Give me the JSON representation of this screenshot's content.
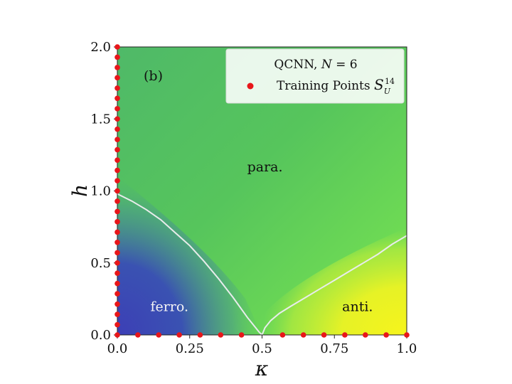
{
  "chart_data": {
    "type": "heatmap",
    "panel_label": "(b)",
    "xlabel": "κ",
    "ylabel": "h",
    "xlim": [
      0,
      1
    ],
    "ylim": [
      0,
      2
    ],
    "xticks": [
      "0.0",
      "0.25",
      "0.5",
      "0.75",
      "1.0"
    ],
    "xtick_values": [
      0,
      0.25,
      0.5,
      0.75,
      1.0
    ],
    "yticks": [
      "0.0",
      "0.5",
      "1.0",
      "1.5",
      "2.0"
    ],
    "ytick_values": [
      0,
      0.5,
      1.0,
      1.5,
      2.0
    ],
    "region_labels": [
      {
        "text": "para.",
        "x": 0.51,
        "y": 1.17
      },
      {
        "text": "ferro.",
        "x": 0.18,
        "y": 0.2
      },
      {
        "text": "anti.",
        "x": 0.83,
        "y": 0.2
      }
    ],
    "colors": {
      "ferro": "#3a48b8",
      "para": "#52c35e",
      "anti": "#f2f51c",
      "boundary": "#e8ecec",
      "training": "#e8161a"
    },
    "legend": {
      "title": "QCNN, N = 6",
      "entry": "Training Points S_U^14",
      "placement": "top-right"
    },
    "boundary_curves": [
      {
        "name": "",
        "x": [
          0.0,
          0.05,
          0.1,
          0.15,
          0.2,
          0.25,
          0.3,
          0.35,
          0.4,
          0.45,
          0.49,
          0.5
        ],
        "y": [
          0.98,
          0.93,
          0.87,
          0.8,
          0.71,
          0.62,
          0.51,
          0.39,
          0.26,
          0.12,
          0.02,
          0.0
        ]
      },
      {
        "name": "",
        "x": [
          0.5,
          0.51,
          0.53,
          0.56,
          0.6,
          0.65,
          0.7,
          0.75,
          0.8,
          0.85,
          0.9,
          0.95,
          1.0
        ],
        "y": [
          0.0,
          0.05,
          0.1,
          0.15,
          0.2,
          0.26,
          0.32,
          0.38,
          0.44,
          0.5,
          0.56,
          0.63,
          0.69
        ]
      }
    ],
    "training_points": {
      "kappa_zero_h": [
        0.0,
        0.071,
        0.143,
        0.214,
        0.286,
        0.357,
        0.429,
        0.5,
        0.571,
        0.643,
        0.714,
        0.786,
        0.857,
        0.929,
        1.0,
        1.071,
        1.143,
        1.214,
        1.286,
        1.357,
        1.429,
        1.5,
        1.571,
        1.643,
        1.714,
        1.786,
        1.857,
        1.929,
        2.0
      ],
      "h_zero_kappa": [
        0.071,
        0.143,
        0.214,
        0.286,
        0.357,
        0.429,
        0.571,
        0.643,
        0.714,
        0.786,
        0.857,
        0.929,
        1.0
      ]
    }
  }
}
